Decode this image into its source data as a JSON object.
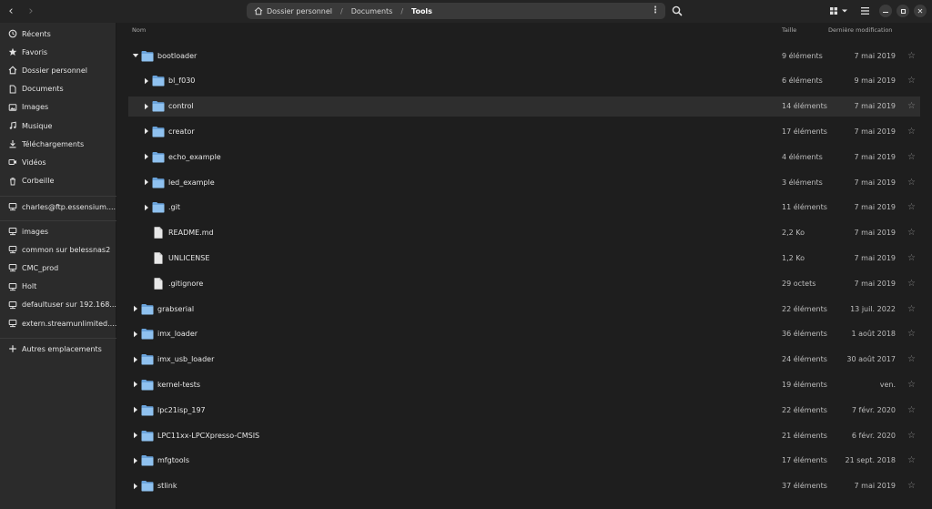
{
  "headerbar": {
    "breadcrumbs": [
      "Dossier personnel",
      "Documents",
      "Tools"
    ]
  },
  "sidebar": {
    "places": [
      {
        "label": "Récents",
        "icon": "clock-icon"
      },
      {
        "label": "Favoris",
        "icon": "star-icon"
      },
      {
        "label": "Dossier personnel",
        "icon": "home-icon"
      },
      {
        "label": "Documents",
        "icon": "document-icon"
      },
      {
        "label": "Images",
        "icon": "image-icon"
      },
      {
        "label": "Musique",
        "icon": "music-icon"
      },
      {
        "label": "Téléchargements",
        "icon": "download-icon"
      },
      {
        "label": "Vidéos",
        "icon": "video-icon"
      },
      {
        "label": "Corbeille",
        "icon": "trash-icon"
      }
    ],
    "remote": [
      {
        "label": "charles@ftp.essensium....",
        "icon": "network-drive-icon"
      }
    ],
    "mounts": [
      {
        "label": "images",
        "icon": "network-drive-icon"
      },
      {
        "label": "common sur belessnas2",
        "icon": "network-drive-icon"
      },
      {
        "label": "CMC_prod",
        "icon": "network-drive-icon"
      },
      {
        "label": "Holt",
        "icon": "network-drive-icon"
      },
      {
        "label": "defaultuser sur 192.168....",
        "icon": "network-drive-icon"
      },
      {
        "label": "extern.streamunlimited....",
        "icon": "network-drive-icon"
      }
    ],
    "other": {
      "label": "Autres emplacements",
      "icon": "plus-icon"
    }
  },
  "columns": {
    "name": "Nom",
    "size": "Taille",
    "modified": "Dernière modification"
  },
  "colors": {
    "folder": "#8fc1ef",
    "folder_dark": "#6aa3db",
    "file": "#e8e8e8"
  },
  "rows": [
    {
      "name": "bootloader",
      "size": "9 éléments",
      "date": "7 mai 2019",
      "type": "folder",
      "depth": 0,
      "expanded": true
    },
    {
      "name": "bl_f030",
      "size": "6 éléments",
      "date": "9 mai 2019",
      "type": "folder",
      "depth": 1,
      "expanded": false
    },
    {
      "name": "control",
      "size": "14 éléments",
      "date": "7 mai 2019",
      "type": "folder",
      "depth": 1,
      "expanded": false,
      "hover": true
    },
    {
      "name": "creator",
      "size": "17 éléments",
      "date": "7 mai 2019",
      "type": "folder",
      "depth": 1,
      "expanded": false
    },
    {
      "name": "echo_example",
      "size": "4 éléments",
      "date": "7 mai 2019",
      "type": "folder",
      "depth": 1,
      "expanded": false
    },
    {
      "name": "led_example",
      "size": "3 éléments",
      "date": "7 mai 2019",
      "type": "folder",
      "depth": 1,
      "expanded": false
    },
    {
      "name": ".git",
      "size": "11 éléments",
      "date": "7 mai 2019",
      "type": "folder",
      "depth": 1,
      "expanded": false
    },
    {
      "name": "README.md",
      "size": "2,2 Ko",
      "date": "7 mai 2019",
      "type": "file",
      "depth": 1
    },
    {
      "name": "UNLICENSE",
      "size": "1,2 Ko",
      "date": "7 mai 2019",
      "type": "file",
      "depth": 1
    },
    {
      "name": ".gitignore",
      "size": "29 octets",
      "date": "7 mai 2019",
      "type": "file",
      "depth": 1
    },
    {
      "name": "grabserial",
      "size": "22 éléments",
      "date": "13 juil. 2022",
      "type": "folder",
      "depth": 0,
      "expanded": false
    },
    {
      "name": "imx_loader",
      "size": "36 éléments",
      "date": "1 août 2018",
      "type": "folder",
      "depth": 0,
      "expanded": false
    },
    {
      "name": "imx_usb_loader",
      "size": "24 éléments",
      "date": "30 août 2017",
      "type": "folder",
      "depth": 0,
      "expanded": false
    },
    {
      "name": "kernel-tests",
      "size": "19 éléments",
      "date": "ven.",
      "type": "folder",
      "depth": 0,
      "expanded": false
    },
    {
      "name": "lpc21isp_197",
      "size": "22 éléments",
      "date": "7 févr. 2020",
      "type": "folder",
      "depth": 0,
      "expanded": false
    },
    {
      "name": "LPC11xx-LPCXpresso-CMSIS",
      "size": "21 éléments",
      "date": "6 févr. 2020",
      "type": "folder",
      "depth": 0,
      "expanded": false
    },
    {
      "name": "mfgtools",
      "size": "17 éléments",
      "date": "21 sept. 2018",
      "type": "folder",
      "depth": 0,
      "expanded": false
    },
    {
      "name": "stlink",
      "size": "37 éléments",
      "date": "7 mai 2019",
      "type": "folder",
      "depth": 0,
      "expanded": false
    }
  ]
}
